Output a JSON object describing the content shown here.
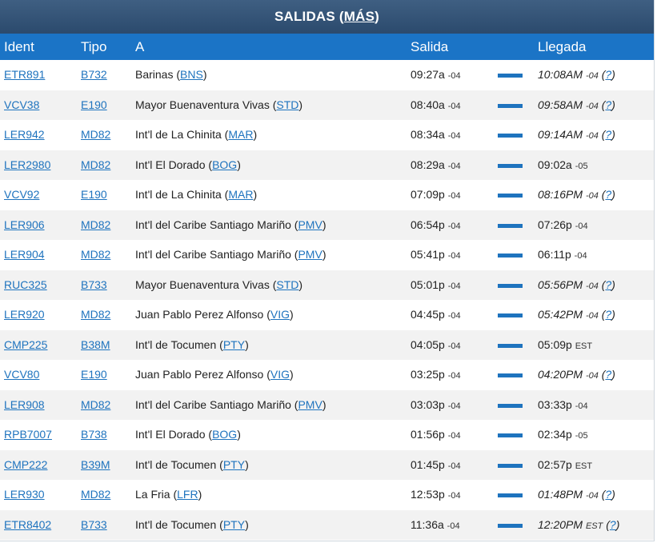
{
  "title": {
    "text": "SALIDAS",
    "link_open": "(",
    "link": "MÁS",
    "link_close": ")"
  },
  "columns": {
    "ident": "Ident",
    "tipo": "Tipo",
    "dest": "A",
    "salida": "Salida",
    "llegada": "Llegada"
  },
  "rows": [
    {
      "ident": "ETR891",
      "tipo": "B732",
      "dest": "Barinas",
      "code": "BNS",
      "dep": "09:27a",
      "dep_tz": "-04",
      "arr": "10:08AM",
      "arr_tz": "-04",
      "est": true
    },
    {
      "ident": "VCV38",
      "tipo": "E190",
      "dest": "Mayor Buenaventura Vivas",
      "code": "STD",
      "dep": "08:40a",
      "dep_tz": "-04",
      "arr": "09:58AM",
      "arr_tz": "-04",
      "est": true
    },
    {
      "ident": "LER942",
      "tipo": "MD82",
      "dest": "Int'l de La Chinita",
      "code": "MAR",
      "dep": "08:34a",
      "dep_tz": "-04",
      "arr": "09:14AM",
      "arr_tz": "-04",
      "est": true
    },
    {
      "ident": "LER2980",
      "tipo": "MD82",
      "dest": "Int'l El Dorado",
      "code": "BOG",
      "dep": "08:29a",
      "dep_tz": "-04",
      "arr": "09:02a",
      "arr_tz": "-05",
      "est": false
    },
    {
      "ident": "VCV92",
      "tipo": "E190",
      "dest": "Int'l de La Chinita",
      "code": "MAR",
      "dep": "07:09p",
      "dep_tz": "-04",
      "arr": "08:16PM",
      "arr_tz": "-04",
      "est": true
    },
    {
      "ident": "LER906",
      "tipo": "MD82",
      "dest": "Int'l del Caribe Santiago Mariño",
      "code": "PMV",
      "dep": "06:54p",
      "dep_tz": "-04",
      "arr": "07:26p",
      "arr_tz": "-04",
      "est": false
    },
    {
      "ident": "LER904",
      "tipo": "MD82",
      "dest": "Int'l del Caribe Santiago Mariño",
      "code": "PMV",
      "dep": "05:41p",
      "dep_tz": "-04",
      "arr": "06:11p",
      "arr_tz": "-04",
      "est": false
    },
    {
      "ident": "RUC325",
      "tipo": "B733",
      "dest": "Mayor Buenaventura Vivas",
      "code": "STD",
      "dep": "05:01p",
      "dep_tz": "-04",
      "arr": "05:56PM",
      "arr_tz": "-04",
      "est": true
    },
    {
      "ident": "LER920",
      "tipo": "MD82",
      "dest": "Juan Pablo Perez Alfonso",
      "code": "VIG",
      "dep": "04:45p",
      "dep_tz": "-04",
      "arr": "05:42PM",
      "arr_tz": "-04",
      "est": true
    },
    {
      "ident": "CMP225",
      "tipo": "B38M",
      "dest": "Int'l de Tocumen",
      "code": "PTY",
      "dep": "04:05p",
      "dep_tz": "-04",
      "arr": "05:09p",
      "arr_tz": "EST",
      "est": false
    },
    {
      "ident": "VCV80",
      "tipo": "E190",
      "dest": "Juan Pablo Perez Alfonso",
      "code": "VIG",
      "dep": "03:25p",
      "dep_tz": "-04",
      "arr": "04:20PM",
      "arr_tz": "-04",
      "est": true
    },
    {
      "ident": "LER908",
      "tipo": "MD82",
      "dest": "Int'l del Caribe Santiago Mariño",
      "code": "PMV",
      "dep": "03:03p",
      "dep_tz": "-04",
      "arr": "03:33p",
      "arr_tz": "-04",
      "est": false
    },
    {
      "ident": "RPB7007",
      "tipo": "B738",
      "dest": "Int'l El Dorado",
      "code": "BOG",
      "dep": "01:56p",
      "dep_tz": "-04",
      "arr": "02:34p",
      "arr_tz": "-05",
      "est": false
    },
    {
      "ident": "CMP222",
      "tipo": "B39M",
      "dest": "Int'l de Tocumen",
      "code": "PTY",
      "dep": "01:45p",
      "dep_tz": "-04",
      "arr": "02:57p",
      "arr_tz": "EST",
      "est": false
    },
    {
      "ident": "LER930",
      "tipo": "MD82",
      "dest": "La Fria",
      "code": "LFR",
      "dep": "12:53p",
      "dep_tz": "-04",
      "arr": "01:48PM",
      "arr_tz": "-04",
      "est": true
    },
    {
      "ident": "ETR8402",
      "tipo": "B733",
      "dest": "Int'l de Tocumen",
      "code": "PTY",
      "dep": "11:36a",
      "dep_tz": "-04",
      "arr": "12:20PM",
      "arr_tz": "EST",
      "est": true
    }
  ],
  "est_marker": "?",
  "colors": {
    "header_bar": "#2b4a6d",
    "column_header": "#1b74c6",
    "link": "#1e73be",
    "row_alt": "#f2f2f2"
  }
}
